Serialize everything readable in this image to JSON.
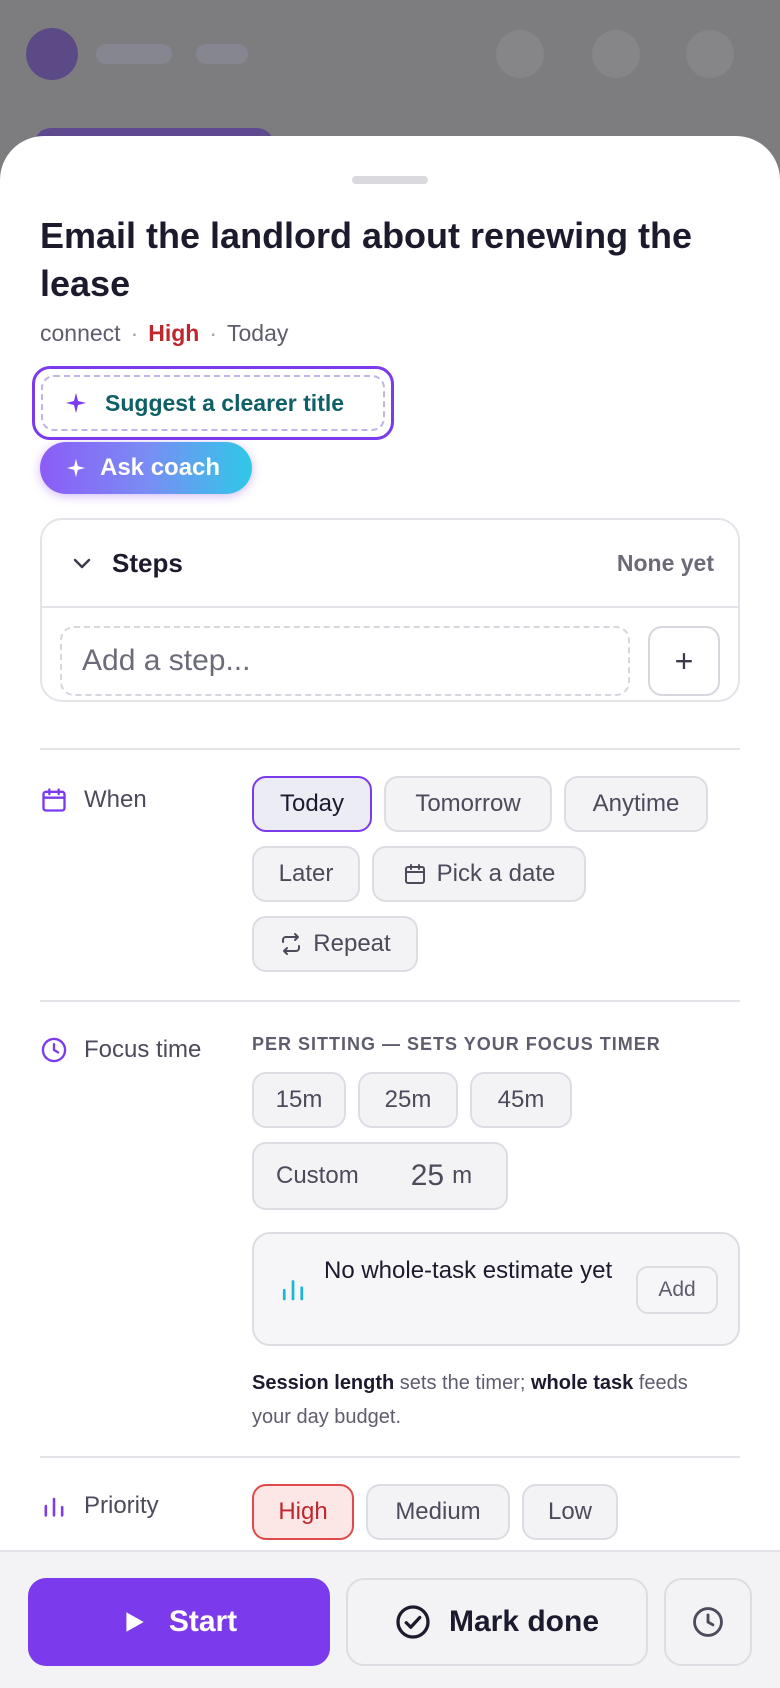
{
  "task": {
    "title": "Email the landlord about renewing the lease",
    "list": "connect",
    "priority": "High",
    "due": "Today",
    "separator": "·"
  },
  "actions": {
    "suggest_title": "Suggest a clearer title",
    "ask_coach": "Ask coach"
  },
  "steps": {
    "label": "Steps",
    "count": "None yet",
    "placeholder": "Add a step...",
    "add_symbol": "+"
  },
  "when": {
    "label": "When",
    "options": [
      "Today",
      "Tomorrow",
      "Anytime",
      "Later",
      "Pick a date",
      "Repeat"
    ],
    "selected": "Today"
  },
  "focus": {
    "label": "Focus time",
    "caption": "PER SITTING — SETS YOUR FOCUS TIMER",
    "presets": [
      "15m",
      "25m",
      "45m"
    ],
    "custom_label": "Custom",
    "custom_value": "25",
    "custom_unit": "m",
    "estimate_text": "No whole-task estimate yet",
    "estimate_add": "Add",
    "note_part1": "Session length",
    "note_part2": " sets the timer; ",
    "note_part3": "whole task",
    "note_part4": " feeds your day budget."
  },
  "priority": {
    "label": "Priority",
    "options": [
      "High",
      "Medium",
      "Low"
    ],
    "selected": "High"
  },
  "bottom": {
    "start": "Start",
    "mark_done": "Mark done"
  },
  "colors": {
    "accent": "#7c3aed",
    "priority_high": "#c0262d",
    "teal_text": "#0f5f66",
    "coach_gradient_end": "#2fc8e8"
  },
  "icons": {
    "sparkle": "sparkle-icon",
    "chevron": "chevron-down-icon",
    "calendar": "calendar-icon",
    "repeat": "repeat-icon",
    "clock": "clock-icon",
    "bars": "bar-chart-icon",
    "play": "play-icon",
    "check": "check-circle-icon"
  }
}
